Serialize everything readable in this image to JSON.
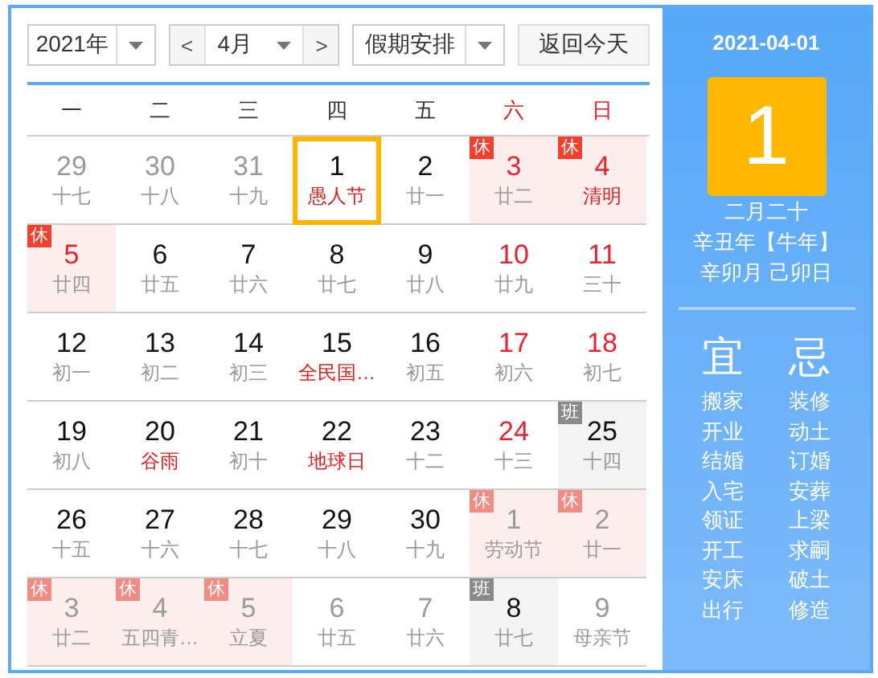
{
  "toolbar": {
    "year": "2021年",
    "prev": "<",
    "month": "4月",
    "next": ">",
    "holiday": "假期安排",
    "today_button": "返回今天"
  },
  "weekdays": [
    {
      "label": "一",
      "weekend": false
    },
    {
      "label": "二",
      "weekend": false
    },
    {
      "label": "三",
      "weekend": false
    },
    {
      "label": "四",
      "weekend": false
    },
    {
      "label": "五",
      "weekend": false
    },
    {
      "label": "六",
      "weekend": true
    },
    {
      "label": "日",
      "weekend": true
    }
  ],
  "days": [
    {
      "day": "29",
      "sub": "十七",
      "muted": true,
      "red": false,
      "festival": false,
      "selected": false
    },
    {
      "day": "30",
      "sub": "十八",
      "muted": true,
      "red": false,
      "festival": false,
      "selected": false
    },
    {
      "day": "31",
      "sub": "十九",
      "muted": true,
      "red": false,
      "festival": false,
      "selected": false
    },
    {
      "day": "1",
      "sub": "愚人节",
      "muted": false,
      "red": false,
      "festival": true,
      "selected": true
    },
    {
      "day": "2",
      "sub": "廿一",
      "muted": false,
      "red": false,
      "festival": false,
      "selected": false
    },
    {
      "day": "3",
      "sub": "廿二",
      "muted": false,
      "red": true,
      "festival": false,
      "selected": false,
      "badge": "休",
      "workday": false
    },
    {
      "day": "4",
      "sub": "清明",
      "muted": false,
      "red": true,
      "festival": true,
      "selected": false,
      "badge": "休",
      "workday": false
    },
    {
      "day": "5",
      "sub": "廿四",
      "muted": false,
      "red": true,
      "festival": false,
      "selected": false,
      "badge": "休",
      "workday": false
    },
    {
      "day": "6",
      "sub": "廿五",
      "muted": false,
      "red": false,
      "festival": false,
      "selected": false
    },
    {
      "day": "7",
      "sub": "廿六",
      "muted": false,
      "red": false,
      "festival": false,
      "selected": false
    },
    {
      "day": "8",
      "sub": "廿七",
      "muted": false,
      "red": false,
      "festival": false,
      "selected": false
    },
    {
      "day": "9",
      "sub": "廿八",
      "muted": false,
      "red": false,
      "festival": false,
      "selected": false
    },
    {
      "day": "10",
      "sub": "廿九",
      "muted": false,
      "red": true,
      "festival": false,
      "selected": false
    },
    {
      "day": "11",
      "sub": "三十",
      "muted": false,
      "red": true,
      "festival": false,
      "selected": false
    },
    {
      "day": "12",
      "sub": "初一",
      "muted": false,
      "red": false,
      "festival": false,
      "selected": false
    },
    {
      "day": "13",
      "sub": "初二",
      "muted": false,
      "red": false,
      "festival": false,
      "selected": false
    },
    {
      "day": "14",
      "sub": "初三",
      "muted": false,
      "red": false,
      "festival": false,
      "selected": false
    },
    {
      "day": "15",
      "sub": "全民国…",
      "muted": false,
      "red": false,
      "festival": true,
      "selected": false
    },
    {
      "day": "16",
      "sub": "初五",
      "muted": false,
      "red": false,
      "festival": false,
      "selected": false
    },
    {
      "day": "17",
      "sub": "初六",
      "muted": false,
      "red": true,
      "festival": false,
      "selected": false
    },
    {
      "day": "18",
      "sub": "初七",
      "muted": false,
      "red": true,
      "festival": false,
      "selected": false
    },
    {
      "day": "19",
      "sub": "初八",
      "muted": false,
      "red": false,
      "festival": false,
      "selected": false
    },
    {
      "day": "20",
      "sub": "谷雨",
      "muted": false,
      "red": false,
      "festival": true,
      "selected": false
    },
    {
      "day": "21",
      "sub": "初十",
      "muted": false,
      "red": false,
      "festival": false,
      "selected": false
    },
    {
      "day": "22",
      "sub": "地球日",
      "muted": false,
      "red": false,
      "festival": true,
      "selected": false
    },
    {
      "day": "23",
      "sub": "十二",
      "muted": false,
      "red": false,
      "festival": false,
      "selected": false
    },
    {
      "day": "24",
      "sub": "十三",
      "muted": false,
      "red": true,
      "festival": false,
      "selected": false
    },
    {
      "day": "25",
      "sub": "十四",
      "muted": false,
      "red": false,
      "festival": false,
      "selected": false,
      "badge": "班",
      "workday": true
    },
    {
      "day": "26",
      "sub": "十五",
      "muted": false,
      "red": false,
      "festival": false,
      "selected": false
    },
    {
      "day": "27",
      "sub": "十六",
      "muted": false,
      "red": false,
      "festival": false,
      "selected": false
    },
    {
      "day": "28",
      "sub": "十七",
      "muted": false,
      "red": false,
      "festival": false,
      "selected": false
    },
    {
      "day": "29",
      "sub": "十八",
      "muted": false,
      "red": false,
      "festival": false,
      "selected": false
    },
    {
      "day": "30",
      "sub": "十九",
      "muted": false,
      "red": false,
      "festival": false,
      "selected": false
    },
    {
      "day": "1",
      "sub": "劳动节",
      "muted": true,
      "red": false,
      "festival": false,
      "selected": false,
      "badge": "休",
      "workday": false
    },
    {
      "day": "2",
      "sub": "廿一",
      "muted": true,
      "red": false,
      "festival": false,
      "selected": false,
      "badge": "休",
      "workday": false
    },
    {
      "day": "3",
      "sub": "廿二",
      "muted": true,
      "red": false,
      "festival": false,
      "selected": false,
      "badge": "休",
      "workday": false
    },
    {
      "day": "4",
      "sub": "五四青…",
      "muted": true,
      "red": false,
      "festival": false,
      "selected": false,
      "badge": "休",
      "workday": false
    },
    {
      "day": "5",
      "sub": "立夏",
      "muted": true,
      "red": false,
      "festival": false,
      "selected": false,
      "badge": "休",
      "workday": false
    },
    {
      "day": "6",
      "sub": "廿五",
      "muted": true,
      "red": false,
      "festival": false,
      "selected": false
    },
    {
      "day": "7",
      "sub": "廿六",
      "muted": true,
      "red": false,
      "festival": false,
      "selected": false
    },
    {
      "day": "8",
      "sub": "廿七",
      "muted": false,
      "red": false,
      "festival": false,
      "selected": false,
      "badge": "班",
      "workday": true
    },
    {
      "day": "9",
      "sub": "母亲节",
      "muted": true,
      "red": false,
      "festival": false,
      "selected": false
    }
  ],
  "detail": {
    "date": "2021-04-01",
    "day": "1",
    "lunar": [
      "二月二十",
      "辛丑年【牛年】",
      "辛卯月 己卯日"
    ],
    "good": {
      "title": "宜",
      "items": [
        "搬家",
        "开业",
        "结婚",
        "入宅",
        "领证",
        "开工",
        "安床",
        "出行"
      ]
    },
    "bad": {
      "title": "忌",
      "items": [
        "装修",
        "动土",
        "订婚",
        "安葬",
        "上梁",
        "求嗣",
        "破土",
        "修造"
      ]
    }
  }
}
